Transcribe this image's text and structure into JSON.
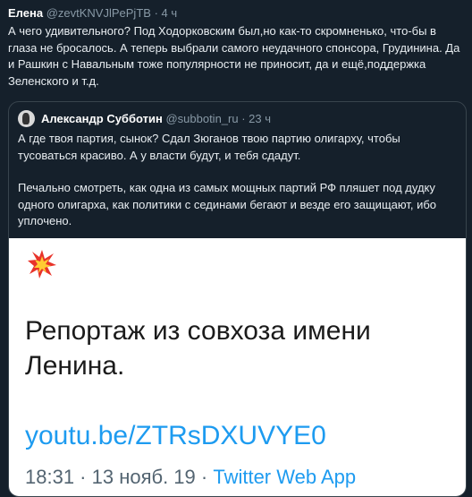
{
  "tweet": {
    "author_name": "Елена",
    "author_handle": "@zevtKNVJlPePjTB",
    "time": "· 4 ч",
    "text": "А чего удивительного? Под Ходорковским был,но как-то скромненько, что-бы в глаза не бросалось. А теперь выбрали самого неудачного спонсора, Грудинина. Да и Рашкин с Навальным тоже популярности не приносит, да и ещё,поддержка Зеленского и т.д."
  },
  "quote": {
    "author_name": "Александр Субботин",
    "author_handle": "@subbotin_ru",
    "time": "· 23 ч",
    "paragraph1": "А где твоя партия, сынок? Сдал Зюганов твою партию олигарху, чтобы тусоваться красиво. А у власти будут, и тебя сдадут.",
    "paragraph2": "Печально смотреть, как одна из самых мощных партий РФ пляшет под дудку одного олигарха, как политики с сединами бегают и везде его защищают, ибо уплочено."
  },
  "media": {
    "icon": "collision-icon",
    "headline": "Репортаж из совхоза имени Ленина.",
    "link": "youtu.be/ZTRsDXUVYE0",
    "footer_time": "18:31 · 13 нояб. 19 · ",
    "footer_app": "Twitter Web App"
  }
}
